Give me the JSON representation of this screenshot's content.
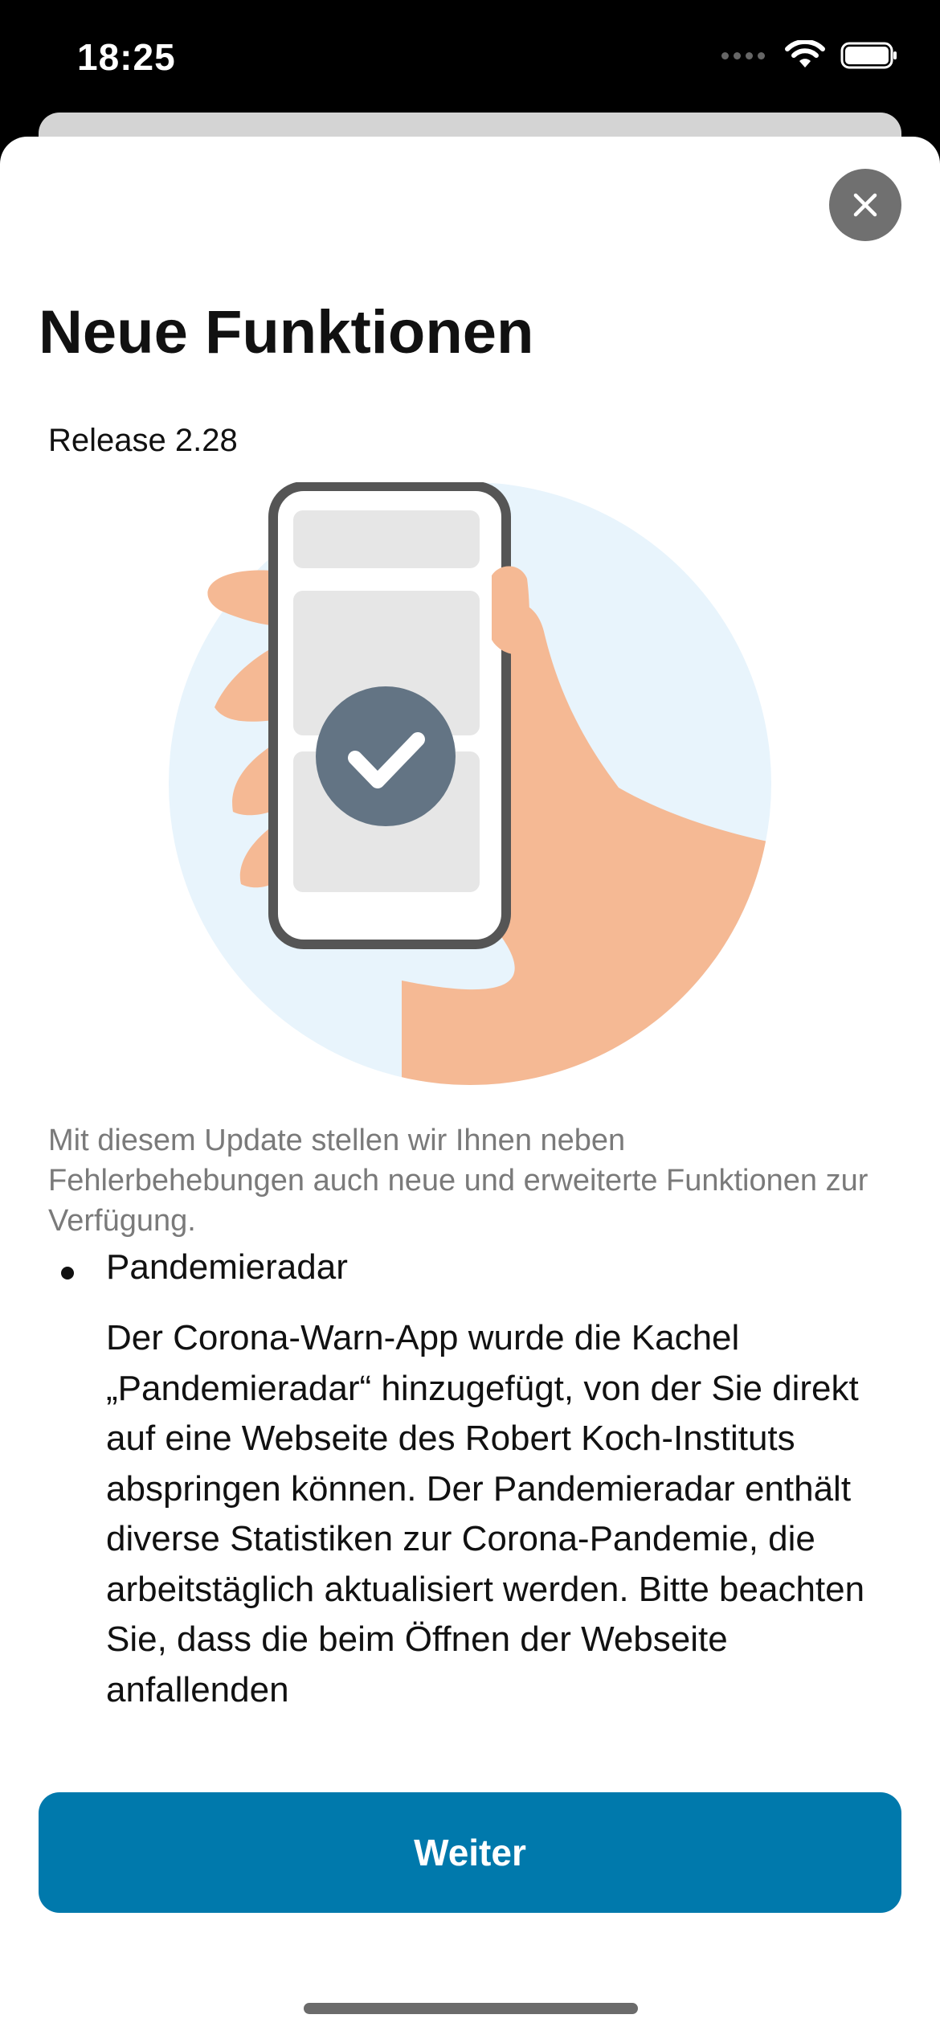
{
  "status_bar": {
    "time": "18:25",
    "icons": [
      "signal-icon",
      "wifi-icon",
      "battery-icon"
    ]
  },
  "sheet": {
    "close_icon": "close-icon",
    "title": "Neue Funktionen",
    "release": "Release 2.28",
    "illustration": "hand-holding-phone-with-checkmark",
    "intro": "Mit diesem Update stellen wir Ihnen neben Fehlerbehebungen auch neue und erweiterte Funktionen zur Verfügung.",
    "features": [
      {
        "title": "Pandemieradar",
        "text": "Der Corona-Warn-App wurde die Kachel „Pandemieradar“ hinzugefügt, von der Sie direkt auf eine Webseite des Robert Koch-Instituts abspringen können. Der Pandemieradar enthält diverse Statistiken zur Corona-Pandemie, die arbeitstäglich aktualisiert werden. Bitte beachten Sie, dass die beim Öffnen der Webseite anfallenden"
      }
    ],
    "continue_label": "Weiter"
  },
  "colors": {
    "accent": "#0079ac",
    "illustration_bg": "#e8f4fc",
    "skin": "#f5b994",
    "check_circle": "#637484"
  }
}
